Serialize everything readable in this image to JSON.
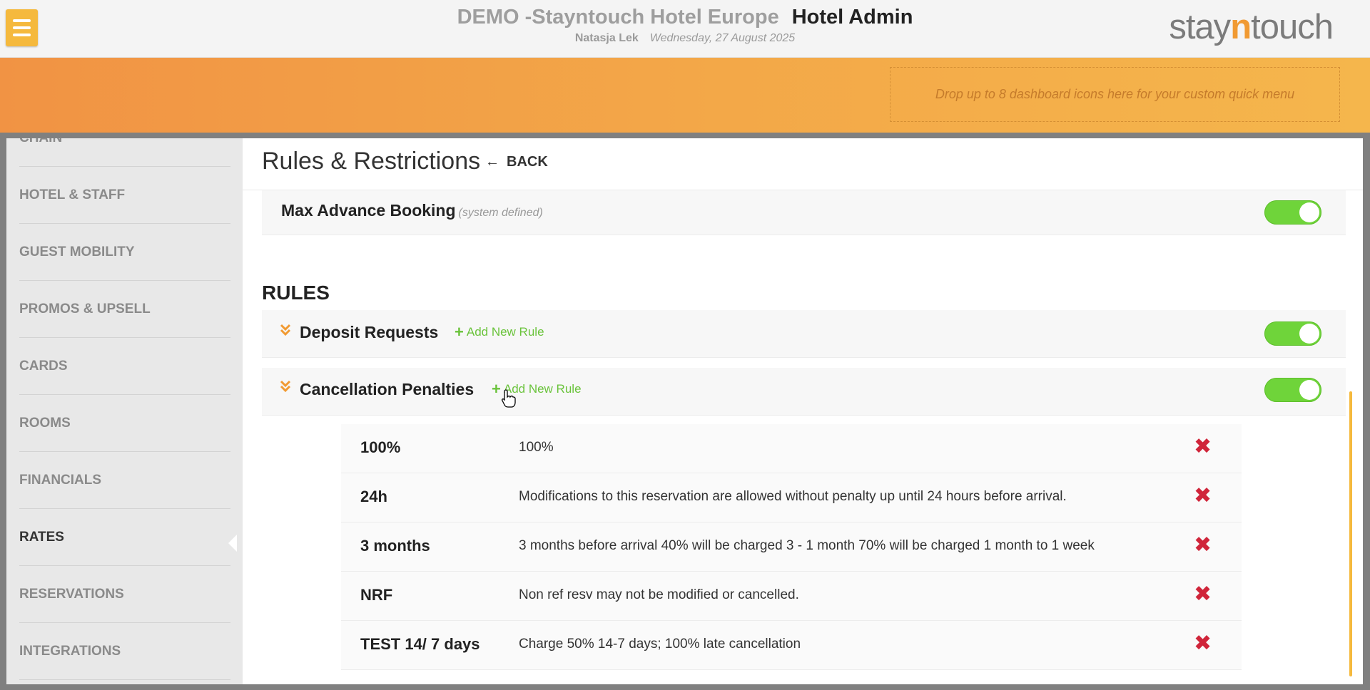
{
  "header": {
    "hotel_name": "DEMO -Stayntouch Hotel Europe",
    "app_name": "Hotel Admin",
    "user": "Natasja Lek",
    "date": "Wednesday, 27 August 2025",
    "logo_prefix": "stay",
    "logo_n": "n",
    "logo_suffix": "touch"
  },
  "quick_menu": {
    "placeholder": "Drop up to 8 dashboard icons here for your custom quick menu"
  },
  "sidebar": {
    "items": [
      {
        "label": "CHAIN"
      },
      {
        "label": "HOTEL & STAFF"
      },
      {
        "label": "GUEST MOBILITY"
      },
      {
        "label": "PROMOS & UPSELL"
      },
      {
        "label": "CARDS"
      },
      {
        "label": "ROOMS"
      },
      {
        "label": "FINANCIALS"
      },
      {
        "label": "RATES"
      },
      {
        "label": "RESERVATIONS"
      },
      {
        "label": "INTEGRATIONS"
      }
    ],
    "active": "RATES"
  },
  "page": {
    "title": "Rules & Restrictions",
    "back_label": "BACK"
  },
  "restrictions": {
    "max_advance": {
      "label": "Max Advance Booking",
      "note": "(system defined)",
      "enabled": true
    }
  },
  "rules": {
    "heading": "RULES",
    "add_label": "Add New Rule",
    "deposit": {
      "label": "Deposit Requests",
      "enabled": true
    },
    "cancellation": {
      "label": "Cancellation Penalties",
      "enabled": true
    },
    "penalties": [
      {
        "name": "100%",
        "description": "100%"
      },
      {
        "name": "24h",
        "description": "Modifications to this reservation are allowed without penalty up until 24 hours before arrival."
      },
      {
        "name": "3 months",
        "description": "3 months before arrival 40% will be charged 3 - 1 month 70% will be charged 1 month to 1 week"
      },
      {
        "name": "NRF",
        "description": "Non ref resv may not be modified or cancelled."
      },
      {
        "name": "TEST 14/ 7 days",
        "description": "Charge 50% 14-7 days; 100% late cancellation"
      }
    ]
  },
  "colors": {
    "accent": "#f19a32",
    "toggle_on": "#6fd43a",
    "delete": "#d0253a",
    "add": "#6ac33b"
  },
  "icons": {
    "menu": "hamburger-icon",
    "back": "arrow-left-icon",
    "expand": "chevron-double-down-icon",
    "add": "plus-icon",
    "delete": "close-x-icon"
  }
}
